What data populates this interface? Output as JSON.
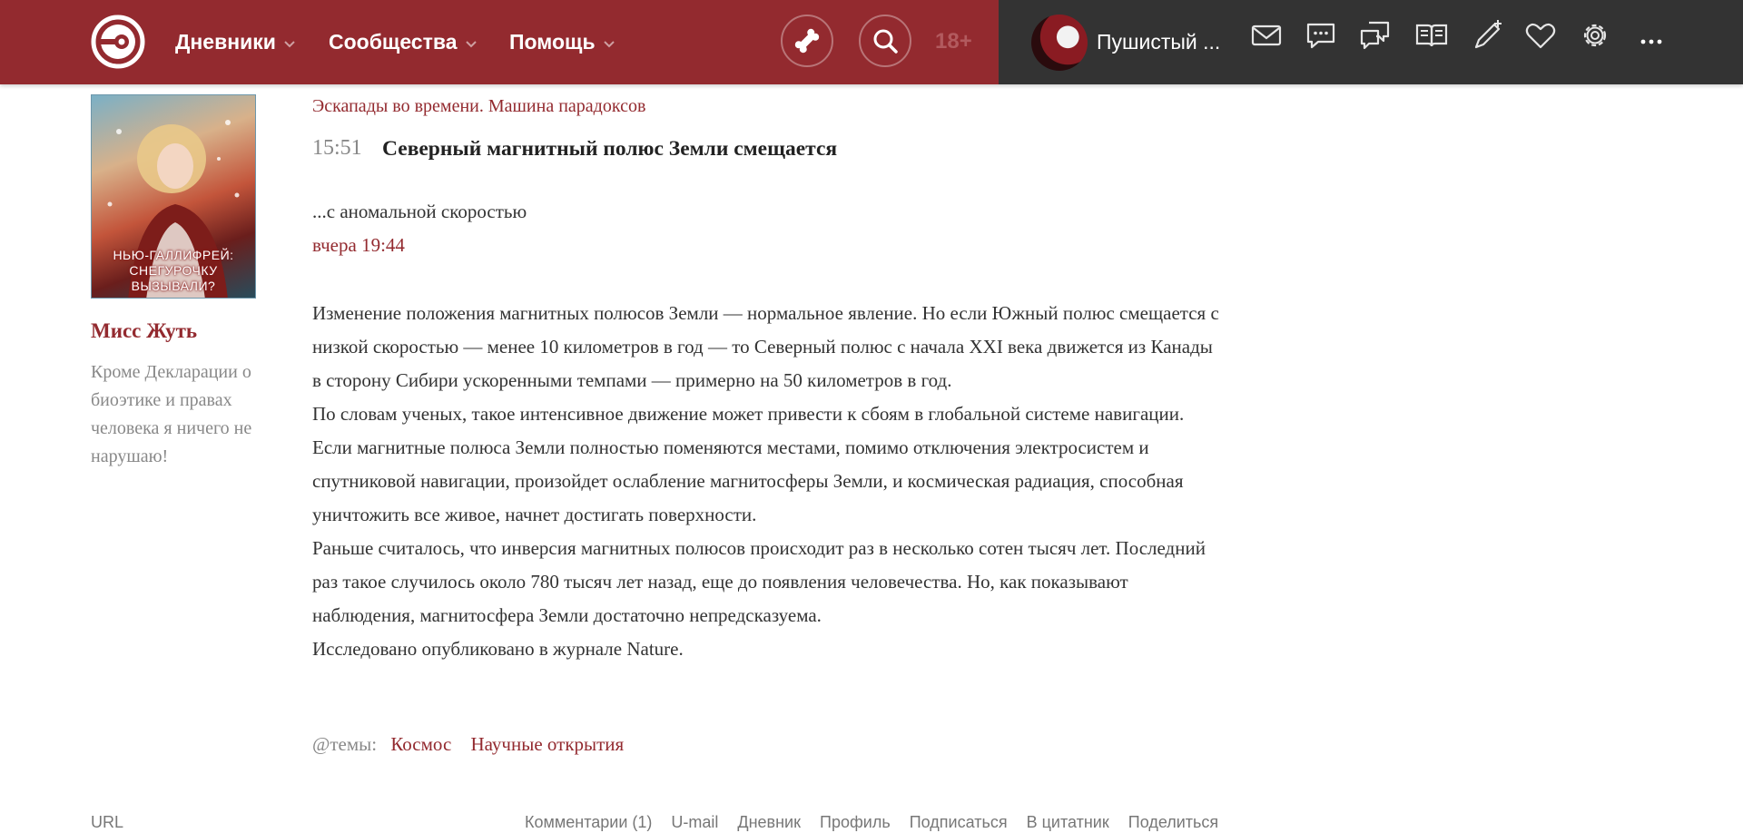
{
  "header": {
    "nav": [
      {
        "label": "Дневники"
      },
      {
        "label": "Сообщества"
      },
      {
        "label": "Помощь"
      }
    ],
    "age_badge": "18+",
    "user": {
      "name": "Пушистый ..."
    },
    "icons": [
      "mail-icon",
      "chat-icon",
      "discussions-icon",
      "book-icon",
      "new-post-icon",
      "favorites-icon",
      "settings-icon",
      "more-icon"
    ],
    "colors": {
      "brand": "#932a2f",
      "dark": "#333333"
    }
  },
  "sidebar": {
    "avatar_caption": "НЬЮ-ГАЛЛИФРЕЙ: СНЕГУРОЧКУ ВЫЗЫВАЛИ?",
    "author_name": "Мисс Жуть",
    "bio": "Кроме Декларации о биоэтике и правах человека я ничего не нарушаю!"
  },
  "post": {
    "journal": "Эскапады во времени. Машина парадоксов",
    "time": "15:51",
    "title": "Северный магнитный полюс Земли смещается",
    "subtitle": "...с аномальной скоростью",
    "date": "вчера 19:44",
    "paragraphs": [
      "Изменение положения магнитных полюсов Земли — нормальное явление. Но если Южный полюс смещается с низкой скоростью — менее 10 километров в год — то Северный полюс с начала XXI века движется из Канады в сторону Сибири ускоренными темпами — примерно на 50 километров в год.",
      "По словам ученых, такое интенсивное движение может привести к сбоям в глобальной системе навигации. Если магнитные полюса Земли полностью поменяются местами, помимо отключения электросистем и спутниковой навигации, произойдет ослабление магнитосферы Земли, и космическая радиация, способная уничтожить все живое, начнет достигать поверхности.",
      "Раньше считалось, что инверсия магнитных полюсов происходит раз в несколько сотен тысяч лет. Последний раз такое случилось около 780 тысяч лет назад, еще до появления человечества. Но, как показывают наблюдения, магнитосфера Земли достаточно непредсказуема.",
      "Исследовано опубликовано в журнале Nature."
    ],
    "tags_label": "@темы:",
    "tags": [
      "Космос",
      "Научные открытия"
    ]
  },
  "footer": {
    "url_label": "URL",
    "links": [
      "Комментарии (1)",
      "U-mail",
      "Дневник",
      "Профиль",
      "Подписаться",
      "В цитатник",
      "Поделиться"
    ]
  }
}
